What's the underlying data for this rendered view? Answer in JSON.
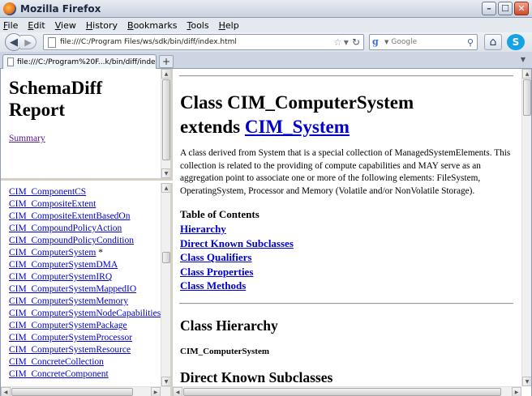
{
  "window": {
    "title": "Mozilla Firefox"
  },
  "menu": [
    "File",
    "Edit",
    "View",
    "History",
    "Bookmarks",
    "Tools",
    "Help"
  ],
  "navbar": {
    "url": "file:///C:/Program Files/ws/sdk/bin/diff/index.html",
    "search_placeholder": "Google"
  },
  "tabs": [
    {
      "label": "file:///C:/Program%20F...k/bin/diff/index.html"
    }
  ],
  "left_top_frame": {
    "title_line1": "SchemaDiff",
    "title_line2": "Report",
    "summary_link": "Summary"
  },
  "class_list": [
    {
      "name": "CIM_ComponentCS",
      "mark": ""
    },
    {
      "name": "CIM_CompositeExtent",
      "mark": ""
    },
    {
      "name": "CIM_CompositeExtentBasedOn",
      "mark": ""
    },
    {
      "name": "CIM_CompoundPolicyAction",
      "mark": ""
    },
    {
      "name": "CIM_CompoundPolicyCondition",
      "mark": ""
    },
    {
      "name": "CIM_ComputerSystem",
      "mark": "*"
    },
    {
      "name": "CIM_ComputerSystemDMA",
      "mark": ""
    },
    {
      "name": "CIM_ComputerSystemIRQ",
      "mark": ""
    },
    {
      "name": "CIM_ComputerSystemMappedIO",
      "mark": ""
    },
    {
      "name": "CIM_ComputerSystemMemory",
      "mark": ""
    },
    {
      "name": "CIM_ComputerSystemNodeCapabilities",
      "mark": ""
    },
    {
      "name": "CIM_ComputerSystemPackage",
      "mark": ""
    },
    {
      "name": "CIM_ComputerSystemProcessor",
      "mark": ""
    },
    {
      "name": "CIM_ComputerSystemResource",
      "mark": ""
    },
    {
      "name": "CIM_ConcreteCollection",
      "mark": ""
    },
    {
      "name": "CIM_ConcreteComponent",
      "mark": ""
    }
  ],
  "main": {
    "heading_line1": "Class CIM_ComputerSystem",
    "heading_extends": "extends",
    "heading_parent": "CIM_System",
    "description": "A class derived from System that is a special collection of ManagedSystemElements. This collection is related to the providing of compute capabilities and MAY serve as an aggregation point to associate one or more of the following elements: FileSystem, OperatingSystem, Processor and Memory (Volatile and/or NonVolatile Storage).",
    "toc_heading": "Table of Contents",
    "toc": [
      "Hierarchy",
      "Direct Known Subclasses",
      "Class Qualifiers",
      "Class Properties",
      "Class Methods"
    ],
    "hierarchy_heading": "Class Hierarchy",
    "hierarchy_item": "CIM_ComputerSystem",
    "subclasses_heading": "Direct Known Subclasses"
  }
}
